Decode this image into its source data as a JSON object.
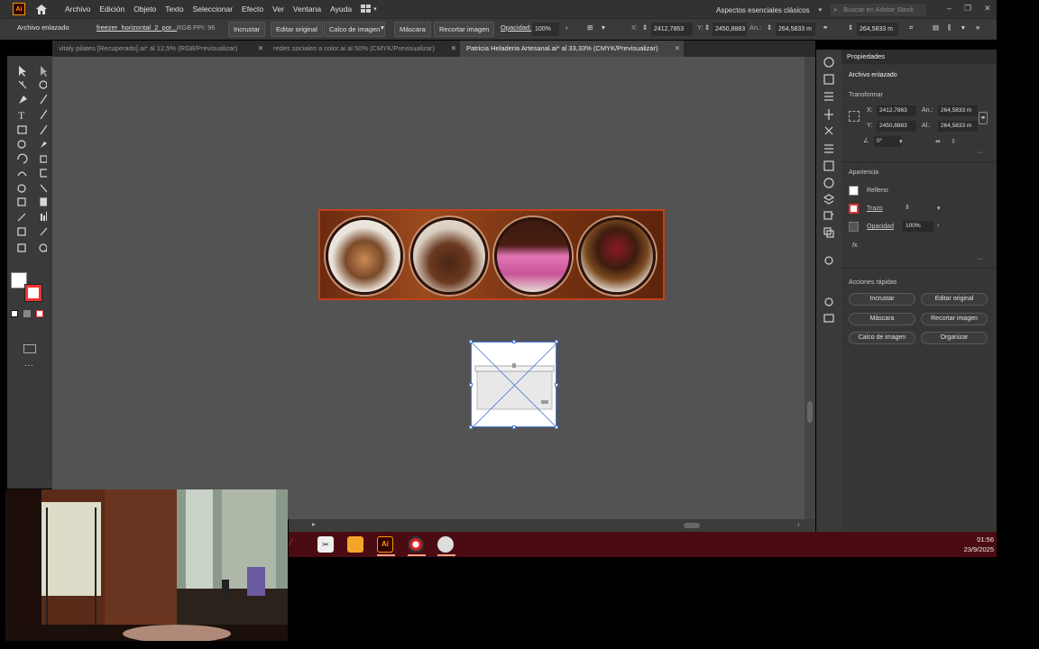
{
  "menubar": {
    "logo": "Ai",
    "items": [
      "Archivo",
      "Edición",
      "Objeto",
      "Texto",
      "Seleccionar",
      "Efecto",
      "Ver",
      "Ventana",
      "Ayuda"
    ],
    "workspace": "Aspectos esenciales clásicos",
    "search_placeholder": "Buscar en Adobe Stock"
  },
  "controlbar": {
    "object_type": "Archivo enlazado",
    "filename": "freezer_horizontal_2_por...",
    "color_mode": "RGB",
    "ppi": "PPI: 96",
    "embed": "Incrustar",
    "edit_original": "Editar original",
    "image_trace": "Calco de imagen",
    "mask": "Máscara",
    "crop": "Recortar imagen",
    "opacity_label": "Opacidad:",
    "opacity_value": "100%",
    "x_label": "X:",
    "x_value": "2412,7863",
    "y_label": "Y:",
    "y_value": "2450,8883",
    "w_label": "An.:",
    "w_value": "264,5833 m",
    "h_label": "Al.:",
    "h_value": "264,5833 m"
  },
  "tabs": [
    {
      "label": "vitaly pilates [Recuperado].ai* al 12,5% (RGB/Previsualizar)",
      "active": false
    },
    {
      "label": "redes sociales a color.ai al 50% (CMYK/Previsualizar)",
      "active": false
    },
    {
      "label": "Patricia Heladeria Artesanal.ai* al 33,33% (CMYK/Previsualizar)",
      "active": true
    }
  ],
  "properties": {
    "tab_label": "Propiedades",
    "object_type": "Archivo enlazado",
    "transform_heading": "Transformar",
    "x_label": "X:",
    "x_value": "2412,7863",
    "y_label": "Y:",
    "y_value": "2450,8883",
    "w_label": "An.:",
    "w_value": "264,5833 m",
    "h_label": "Al.:",
    "h_value": "264,5833 m",
    "angle_value": "0°",
    "appearance_heading": "Apariencia",
    "fill_label": "Relleno",
    "stroke_label": "Trazo",
    "opacity_label": "Opacidad",
    "opacity_value": "100%",
    "fx_label": "fx.",
    "quick_actions_heading": "Acciones rápidas",
    "btn_embed": "Incrustar",
    "btn_edit_original": "Editar original",
    "btn_mask": "Máscara",
    "btn_crop": "Recortar imagen",
    "btn_trace": "Calco de imagen",
    "btn_arrange": "Organizar"
  },
  "taskbar": {
    "time": "01:56",
    "date": "23/9/2025"
  },
  "colors": {
    "accent_banner_border": "#c2401a",
    "taskbar": "#4a0b12",
    "selection": "#4a7bd8"
  }
}
